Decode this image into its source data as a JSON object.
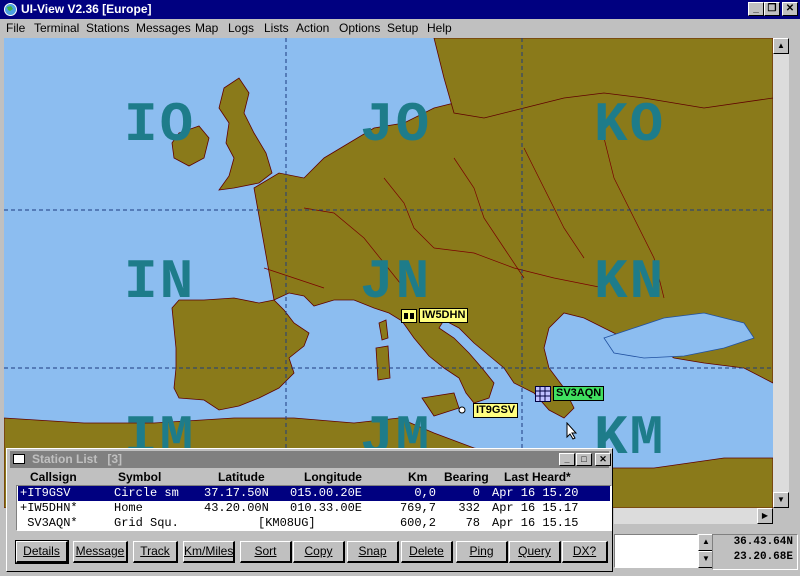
{
  "window": {
    "title": "UI-View V2.36 [Europe]",
    "minimize": "_",
    "restore": "❐",
    "close": "✕"
  },
  "menu": [
    "File",
    "Terminal",
    "Stations",
    "Messages",
    "Map",
    "Logs",
    "Lists",
    "Action",
    "Options",
    "Setup",
    "Help"
  ],
  "map": {
    "grid_labels": [
      "IO",
      "JO",
      "KO",
      "IN",
      "JN",
      "KN",
      "IM",
      "JM",
      "KM"
    ],
    "stations": [
      {
        "callsign": "IW5DHN",
        "tag_color": "#ffff80"
      },
      {
        "callsign": "IT9GSV",
        "tag_color": "#ffff80"
      },
      {
        "callsign": "SV3AQN",
        "tag_color": "#40e060"
      }
    ]
  },
  "station_list": {
    "title": "Station List",
    "count": "[3]",
    "columns": {
      "callsign": "Callsign",
      "symbol": "Symbol",
      "latitude": "Latitude",
      "longitude": "Longitude",
      "km": "Km",
      "bearing": "Bearing",
      "last_heard": "Last Heard*"
    },
    "rows": [
      {
        "callsign": "+IT9GSV",
        "symbol": "Circle sm",
        "latitude": "37.17.50N",
        "longitude": "015.00.20E",
        "km": "0,0",
        "bearing": "0",
        "last_heard": "Apr 16 15.20"
      },
      {
        "callsign": "+IW5DHN*",
        "symbol": "Home",
        "latitude": "43.20.00N",
        "longitude": "010.33.00E",
        "km": "769,7",
        "bearing": "332",
        "last_heard": "Apr 16 15.17"
      },
      {
        "callsign": " SV3AQN*",
        "symbol": "Grid Squ.",
        "latitude": "[KM08UG]",
        "longitude": "",
        "km": "600,2",
        "bearing": "78",
        "last_heard": "Apr 16 15.15"
      }
    ],
    "buttons": [
      "Details",
      "Message",
      "Track",
      "Km/Miles",
      "Sort",
      "Copy",
      "Snap",
      "Delete",
      "Ping",
      "Query",
      "DX?"
    ]
  },
  "status": {
    "latitude": "36.43.64N",
    "longitude": "23.20.68E"
  },
  "colors": {
    "titlebar": "#000080",
    "sea": "#8cbdf0",
    "land": "#8a7a1a",
    "grid_label": "#1e7c8a"
  }
}
